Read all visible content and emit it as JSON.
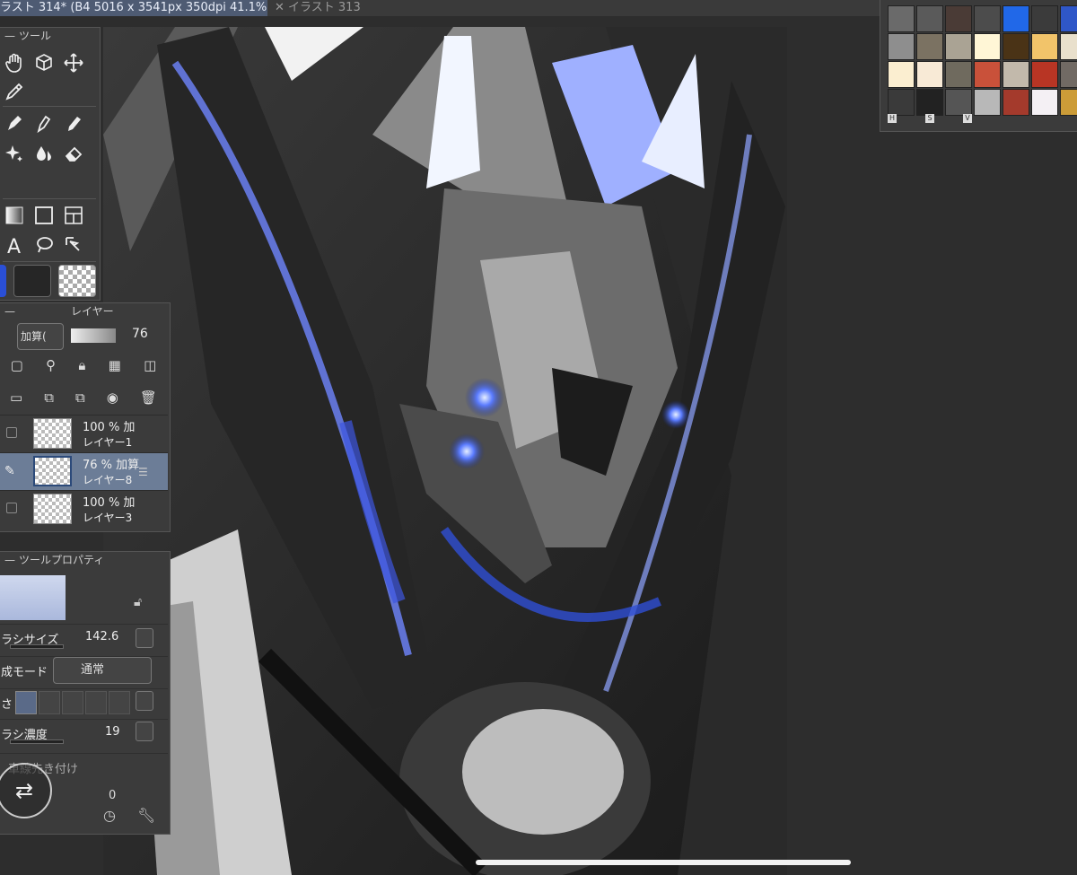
{
  "tabs": [
    {
      "label": "ラスト 314* (B4 5016 x 3541px 350dpi 41.1%)",
      "active": true
    },
    {
      "label": "✕ イラスト 313",
      "active": false
    }
  ],
  "tool_panel": {
    "title": "ツール",
    "tools": [
      "hand-icon",
      "rotate-cube-icon",
      "move-icon",
      "eyedropper-icon",
      "pen-icon",
      "fountain-pen-icon",
      "marker-icon",
      "sparkle-icon",
      "blend-drop-icon",
      "eraser-icon",
      "gradient-icon",
      "rectangle-icon",
      "frame-icon",
      "text-icon",
      "lasso-icon",
      "select-pointer-icon"
    ],
    "main_color": "#2a4fd6",
    "sub_color": "#262626"
  },
  "layer_panel": {
    "title": "レイヤー",
    "blend_mode": "加算(",
    "opacity": "76",
    "layers": [
      {
        "opacity": "100 % 加",
        "name": "レイヤー1",
        "selected": false
      },
      {
        "opacity": "76 % 加算",
        "name": "レイヤー8",
        "selected": true
      },
      {
        "opacity": "100 % 加",
        "name": "レイヤー3",
        "selected": false
      }
    ]
  },
  "tool_property": {
    "title": "ツールプロパティ",
    "brush_size_label": "ラシサイズ",
    "brush_size": "142.6",
    "blend_label": "成モード",
    "blend_value": "通常",
    "hardness_label": "さ",
    "density_label": "ラシ濃度",
    "density": "19",
    "stabilize_label": "車線先き付け",
    "bottom_value": "0"
  },
  "palette": {
    "colors": [
      [
        "#6a6a6a",
        "#5a5a5a",
        "#4a3b36",
        "#4c4c4c",
        "#2168e8",
        "#3b3b3b",
        "#2f57c8"
      ],
      [
        "#8e8e8e",
        "#7b7262",
        "#aaa394",
        "#fff6d6",
        "#4a3316",
        "#f2c46a",
        "#e9e0cc"
      ],
      [
        "#fbeed0",
        "#f8ead6",
        "#6f6a5e",
        "#c9513a",
        "#c2b9ab",
        "#b83524",
        "#716a64"
      ],
      [
        "#3a3a3a",
        "#222222",
        "#555555",
        "#b8b8b8",
        "#a43a2c",
        "#f4f0f4",
        "#cc9c38"
      ]
    ],
    "top_row": [
      "#9a9a9a",
      "#bfbfbf",
      "#222222",
      "#111111",
      "#c9924a",
      "#7a1c1c",
      "#c01c1c"
    ],
    "hsv_labels": [
      "H",
      "S",
      "V"
    ]
  }
}
